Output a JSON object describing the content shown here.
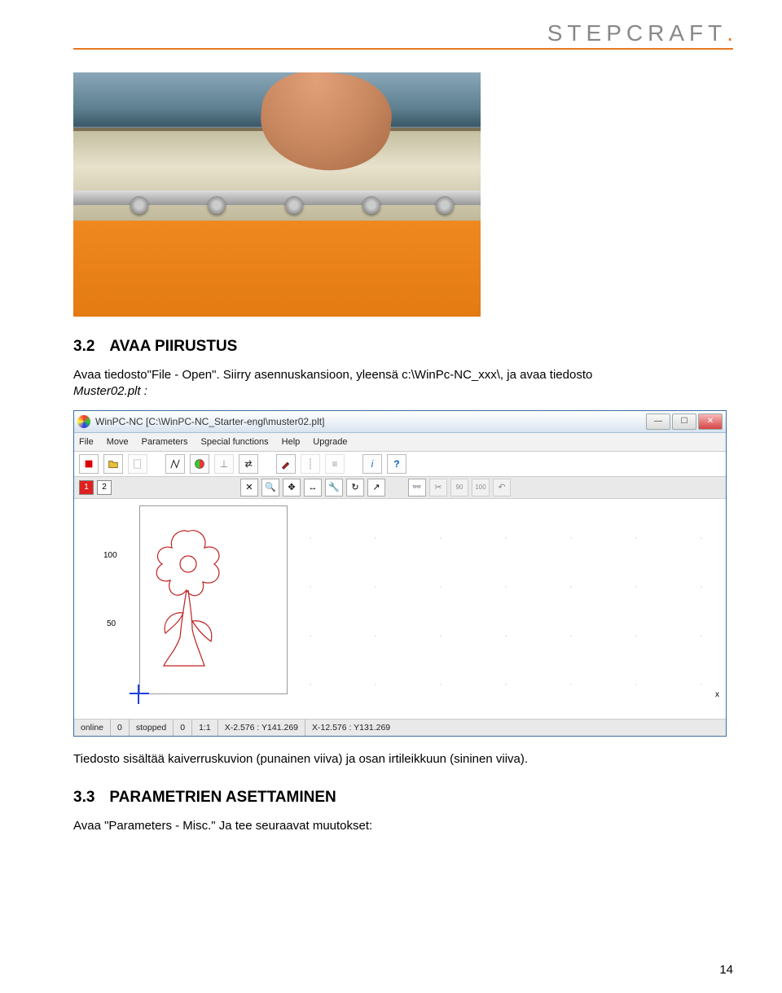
{
  "brand": "STEPCRAFT",
  "section32": {
    "number": "3.2",
    "title": "AVAA PIIRUSTUS",
    "line1": "Avaa tiedosto\"File - Open\". Siirry asennuskansioon, yleensä c:\\WinPc-NC_xxx\\, ja avaa tiedosto",
    "line2_italic": "Muster02.plt :"
  },
  "screenshot": {
    "title": "WinPC-NC [C:\\WinPC-NC_Starter-engl\\muster02.plt]",
    "menus": [
      "File",
      "Move",
      "Parameters",
      "Special functions",
      "Help",
      "Upgrade"
    ],
    "tabs": [
      "1",
      "2"
    ],
    "yTicks": {
      "100": "100",
      "50": "50"
    },
    "xAxisLabel": "x",
    "status": {
      "online": "online",
      "zero1": "0",
      "stopped": "stopped",
      "zero2": "0",
      "scale": "1:1",
      "coord1": "X-2.576 : Y141.269",
      "coord2": "X-12.576 : Y131.269"
    }
  },
  "after_screenshot": "Tiedosto sisältää kaiverruskuvion (punainen viiva) ja osan irtileikkuun (sininen viiva).",
  "section33": {
    "number": "3.3",
    "title": "PARAMETRIEN ASETTAMINEN",
    "line1": "Avaa \"Parameters - Misc.\" Ja tee seuraavat muutokset:"
  },
  "pageNumber": "14"
}
